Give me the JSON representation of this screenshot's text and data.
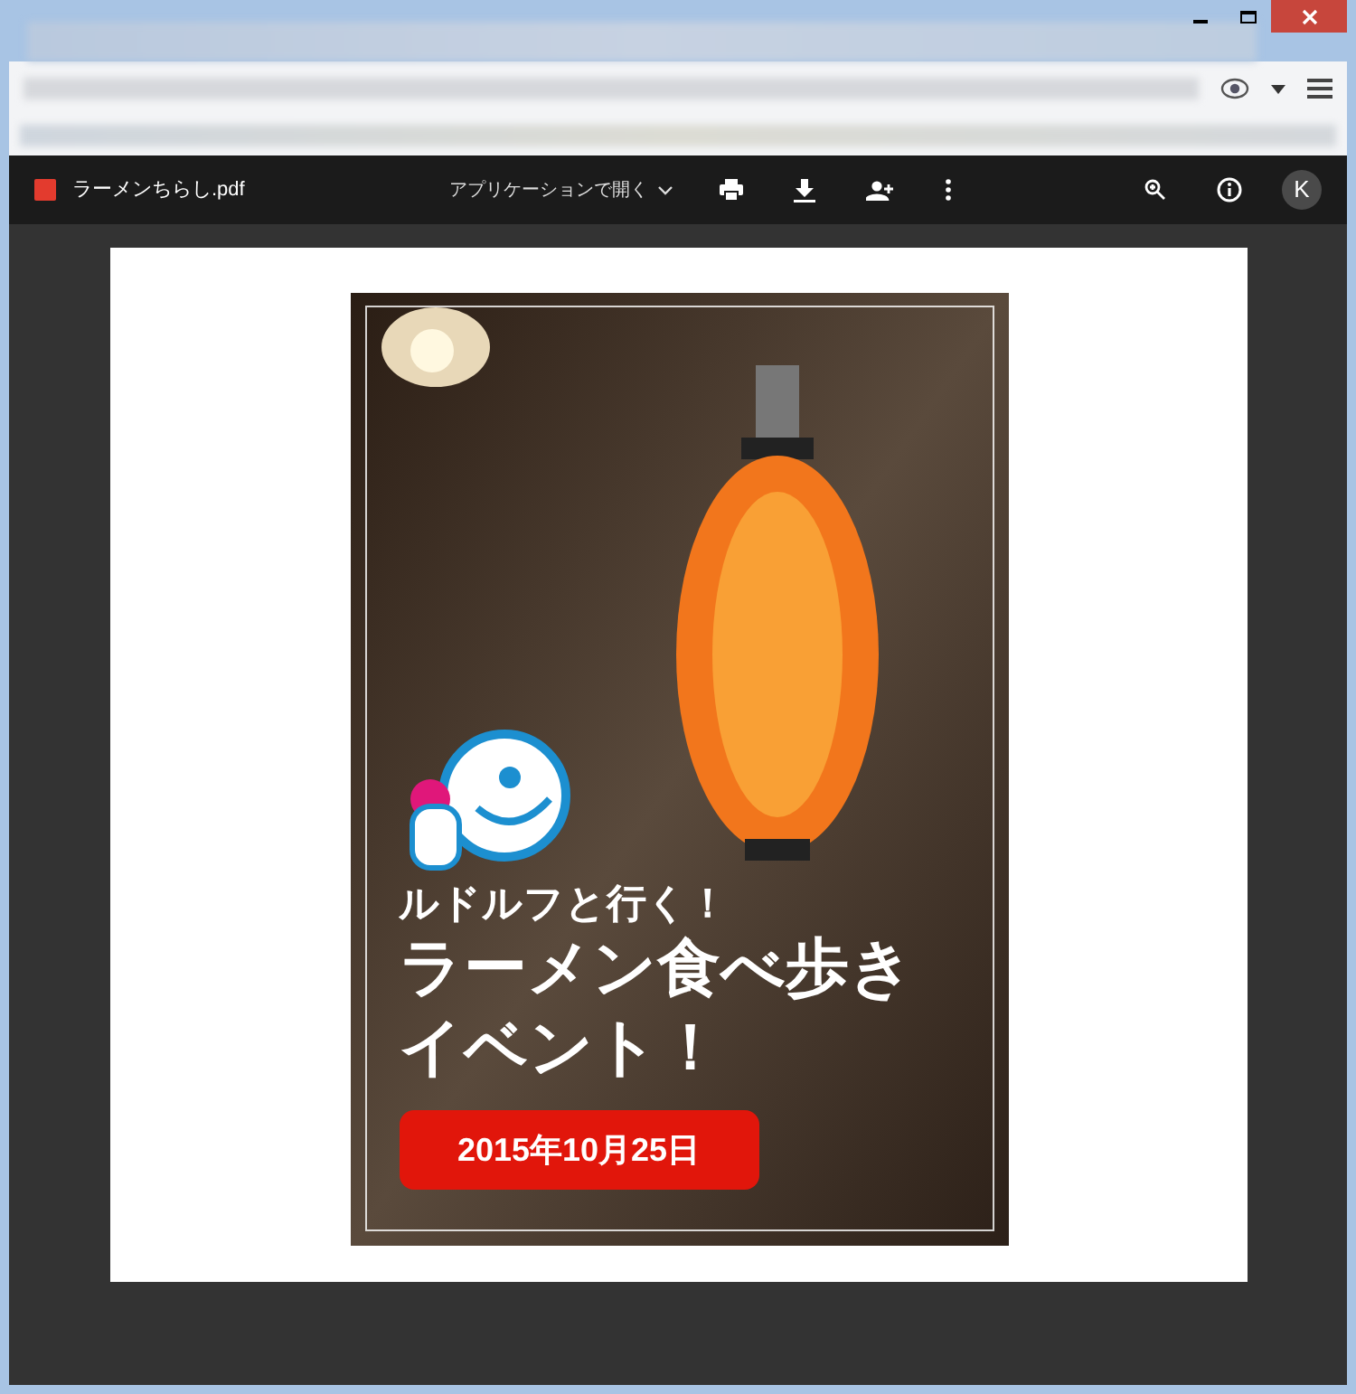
{
  "pdf_toolbar": {
    "file_name": "ラーメンちらし.pdf",
    "open_with": "アプリケーションで開く",
    "avatar": "K"
  },
  "poster": {
    "subtitle": "ルドルフと行く！",
    "title_lines": [
      "ラーメン食べ歩き",
      "イベント！"
    ],
    "date": "2015年10月25日"
  }
}
